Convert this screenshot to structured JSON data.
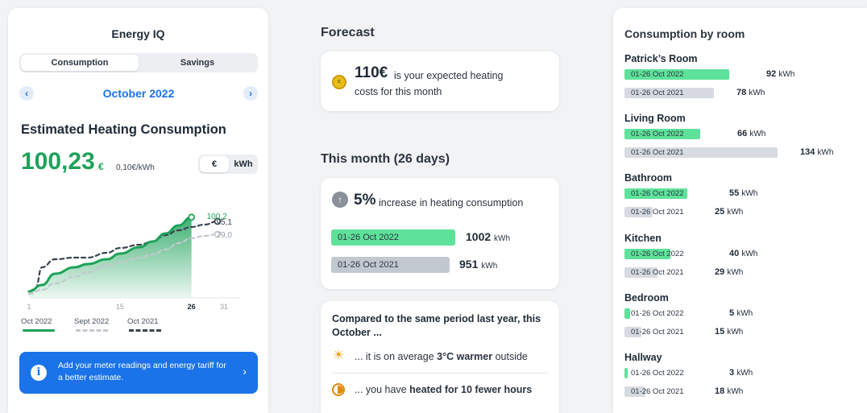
{
  "left": {
    "app_title": "Energy IQ",
    "tabs": [
      "Consumption",
      "Savings"
    ],
    "month": "October 2022",
    "estimate_title": "Estimated Heating Consumption",
    "big_value": "100,23",
    "big_unit": "€",
    "tariff": "0,10€/kWh",
    "unit_options": [
      "€",
      "kWh"
    ],
    "banner_text": "Add your meter readings and energy tariff for a better estimate.",
    "legend": [
      "Oct 2022",
      "Sept 2022",
      "Oct 2021"
    ],
    "colors": {
      "green": "#1ea25a",
      "dark": "#3a4350",
      "gray": "#aab1ba",
      "accent": "#1a73e8"
    }
  },
  "chart_data": {
    "type": "area",
    "x_ticks": [
      "1",
      "15",
      "26",
      "31"
    ],
    "x_domain": [
      1,
      31
    ],
    "y_domain": [
      0,
      120
    ],
    "end_labels": [
      "100,2",
      "95,1",
      "79,0"
    ],
    "series": [
      {
        "name": "Oct 2022",
        "x": [
          1,
          3,
          5,
          8,
          10,
          13,
          15,
          18,
          20,
          22,
          24,
          26
        ],
        "y": [
          8,
          16,
          30,
          38,
          42,
          48,
          55,
          63,
          70,
          80,
          90,
          100.2
        ]
      },
      {
        "name": "Sept 2022",
        "x": [
          1,
          3,
          5,
          8,
          10,
          13,
          15,
          18,
          20,
          22,
          24,
          26,
          28,
          30
        ],
        "y": [
          5,
          10,
          18,
          26,
          32,
          40,
          44,
          50,
          54,
          60,
          68,
          74,
          77,
          79.0
        ]
      },
      {
        "name": "Oct 2021",
        "x": [
          1,
          2,
          3,
          5,
          8,
          10,
          13,
          15,
          18,
          20,
          22,
          24,
          26,
          28,
          30
        ],
        "y": [
          8,
          12,
          38,
          48,
          50,
          50,
          56,
          62,
          66,
          70,
          78,
          84,
          88,
          91,
          95.1
        ]
      }
    ]
  },
  "forecast": {
    "section_title": "Forecast",
    "coin_glyph": "c",
    "amount": "110€",
    "text_line1": "is your expected heating",
    "text_line2": "costs for this month"
  },
  "this_month": {
    "section_title": "This month (26 days)",
    "percent": "5%",
    "percent_text": "increase in heating consumption",
    "current": {
      "label": "01-26 Oct 2022",
      "value": "1002",
      "unit": "kWh"
    },
    "previous": {
      "label": "01-26 Oct 2021",
      "value": "951",
      "unit": "kWh"
    }
  },
  "compare": {
    "title": "Compared to the same period last year, this October ...",
    "line1_prefix": "... it is on average",
    "line1_bold": "3°C warmer",
    "line1_suffix": "outside",
    "line2_prefix": "... you have",
    "line2_bold": "heated for 10 fewer hours"
  },
  "rooms": {
    "title": "Consumption by room",
    "max_kwh": 134,
    "items": [
      {
        "name": "Patrick’s Room",
        "cur_label": "01-26 Oct 2022",
        "cur_value": 92,
        "prev_label": "01-26 Oct 2021",
        "prev_value": 78,
        "unit": "kWh"
      },
      {
        "name": "Living Room",
        "cur_label": "01-26 Oct 2022",
        "cur_value": 66,
        "prev_label": "01-26 Oct 2021",
        "prev_value": 134,
        "unit": "kWh"
      },
      {
        "name": "Bathroom",
        "cur_label": "01-26 Oct 2022",
        "cur_value": 55,
        "prev_label": "01-26 Oct 2021",
        "prev_value": 25,
        "unit": "kWh"
      },
      {
        "name": "Kitchen",
        "cur_label": "01-26 Oct 2022",
        "cur_value": 40,
        "prev_label": "01-26 Oct 2021",
        "prev_value": 29,
        "unit": "kWh"
      },
      {
        "name": "Bedroom",
        "cur_label": "01-26 Oct 2022",
        "cur_value": 5,
        "prev_label": "01-26 Oct 2021",
        "prev_value": 15,
        "unit": "kWh"
      },
      {
        "name": "Hallway",
        "cur_label": "01-26 Oct 2022",
        "cur_value": 3,
        "prev_label": "01-26 Oct 2021",
        "prev_value": 18,
        "unit": "kWh"
      }
    ]
  }
}
